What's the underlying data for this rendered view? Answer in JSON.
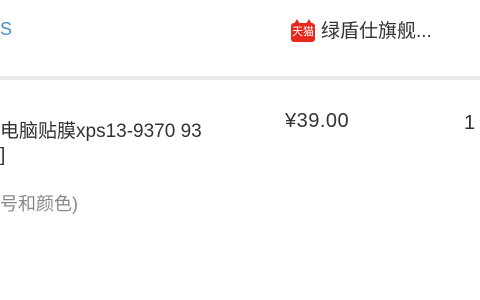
{
  "header": {
    "left_text": "S",
    "shop_badge": "天猫",
    "shop_name": "绿盾仕旗舰..."
  },
  "item": {
    "title_line1": "电脑贴膜xps13-9370 93",
    "title_line2": "]",
    "spec": "号和颜色)",
    "price": "¥39.00",
    "quantity": "1"
  },
  "colors": {
    "accent_link": "#4a90c8",
    "tmall_red": "#e8281b",
    "divider": "#e9e9e9",
    "text_main": "#333333",
    "text_muted": "#888888"
  }
}
